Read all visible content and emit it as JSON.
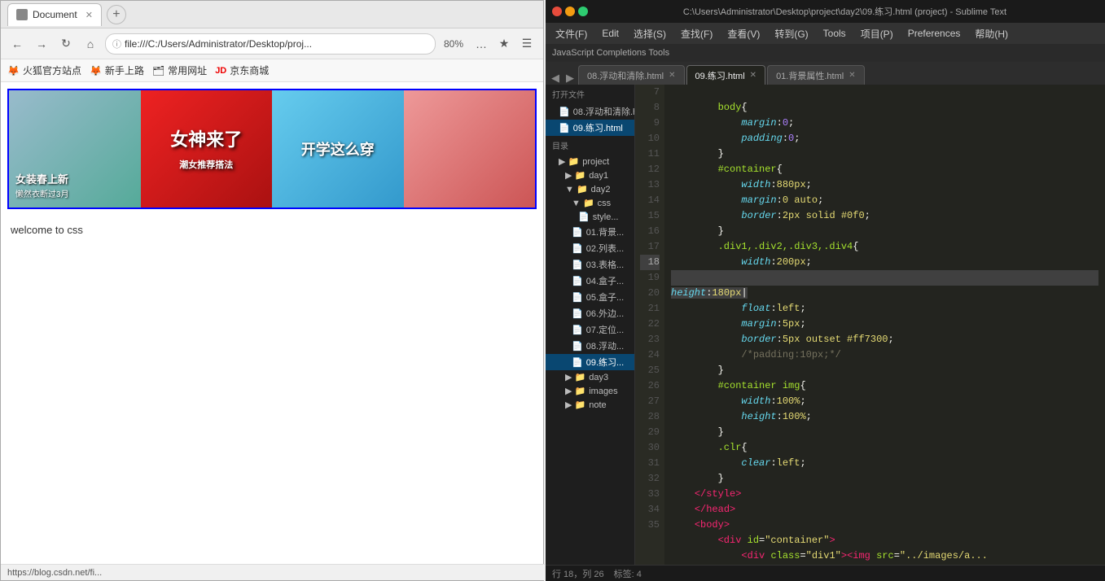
{
  "browser": {
    "tab_label": "Document",
    "tab_favicon": "doc",
    "address": "file:///C:/Users/Administrator/Desktop/proj...",
    "zoom": "80%",
    "bookmarks": [
      {
        "label": "火狐官方站点",
        "icon": "🦊"
      },
      {
        "label": "新手上路",
        "icon": "🦊"
      },
      {
        "label": "常用网址",
        "icon": "🗂"
      },
      {
        "label": "京东商城",
        "icon": "🛒"
      }
    ],
    "welcome_text": "welcome to css",
    "status_url": "https://blog.csdn.net/fi..."
  },
  "images": [
    {
      "label": "女装春上新",
      "sublabel": "懒然衣断过3月"
    },
    {
      "label": "女神来了",
      "sublabel": "潮女推荐搭法"
    },
    {
      "label": "开学这么穿",
      "sublabel": ""
    },
    {
      "label": "",
      "sublabel": ""
    }
  ],
  "sublime": {
    "title": "C:\\Users\\Administrator\\Desktop\\project\\day2\\09.练习.html (project) - Sublime Text",
    "nav_prev": "◀",
    "nav_next": "▶",
    "menu_items": [
      "文件(F)",
      "Edit",
      "选择(S)",
      "查找(F)",
      "查看(V)",
      "转到(G)",
      "Tools",
      "项目(P)",
      "Preferences",
      "帮助(H)"
    ],
    "toolbar_text": "JavaScript Completions Tools",
    "tabs": [
      {
        "label": "08.浮动和清除.html",
        "active": false
      },
      {
        "label": "09.练习.html",
        "active": true
      },
      {
        "label": "01.背景属性.html",
        "active": false
      }
    ],
    "sidebar": {
      "open_files_title": "打开文件",
      "sidebar_items": [
        {
          "label": "08.浮动和清除.html",
          "type": "file",
          "indent": 1,
          "selected": false
        },
        {
          "label": "09.练习.html",
          "type": "file",
          "indent": 1,
          "selected": true
        },
        {
          "label": "目录",
          "type": "folder",
          "indent": 0,
          "selected": false
        },
        {
          "label": "project",
          "type": "folder",
          "indent": 1,
          "selected": false
        },
        {
          "label": "day1",
          "type": "folder",
          "indent": 2,
          "selected": false
        },
        {
          "label": "day2",
          "type": "folder",
          "indent": 2,
          "selected": false
        },
        {
          "label": "css",
          "type": "folder",
          "indent": 3,
          "selected": false
        },
        {
          "label": "style...",
          "type": "file",
          "indent": 4,
          "selected": false
        },
        {
          "label": "01.背景...",
          "type": "file",
          "indent": 3,
          "selected": false
        },
        {
          "label": "02.列表...",
          "type": "file",
          "indent": 3,
          "selected": false
        },
        {
          "label": "03.表格...",
          "type": "file",
          "indent": 3,
          "selected": false
        },
        {
          "label": "04.盒子...",
          "type": "file",
          "indent": 3,
          "selected": false
        },
        {
          "label": "05.盒子...",
          "type": "file",
          "indent": 3,
          "selected": false
        },
        {
          "label": "06.外边...",
          "type": "file",
          "indent": 3,
          "selected": false
        },
        {
          "label": "07.定位...",
          "type": "file",
          "indent": 3,
          "selected": false
        },
        {
          "label": "08.浮动...",
          "type": "file",
          "indent": 3,
          "selected": false
        },
        {
          "label": "09.练习...",
          "type": "file",
          "indent": 3,
          "selected": false
        },
        {
          "label": "day3",
          "type": "folder",
          "indent": 2,
          "selected": false
        },
        {
          "label": "images",
          "type": "folder",
          "indent": 2,
          "selected": false
        },
        {
          "label": "note",
          "type": "folder",
          "indent": 2,
          "selected": false
        }
      ]
    },
    "code_lines": [
      {
        "num": 7,
        "content": "BODY_OPEN"
      },
      {
        "num": 8,
        "content": "MARGIN"
      },
      {
        "num": 9,
        "content": "PADDING"
      },
      {
        "num": 10,
        "content": "CLOSE_BRACE"
      },
      {
        "num": 11,
        "content": "CONTAINER_OPEN"
      },
      {
        "num": 12,
        "content": "WIDTH_880"
      },
      {
        "num": 13,
        "content": "MARGIN_AUTO"
      },
      {
        "num": 14,
        "content": "BORDER"
      },
      {
        "num": 15,
        "content": "CLOSE_BRACE"
      },
      {
        "num": 16,
        "content": "DIV_SELECTOR"
      },
      {
        "num": 17,
        "content": "WIDTH_200"
      },
      {
        "num": 18,
        "content": "HEIGHT_180"
      },
      {
        "num": 19,
        "content": "FLOAT"
      },
      {
        "num": 20,
        "content": "MARGIN_5"
      },
      {
        "num": 21,
        "content": "BORDER_OUTSET"
      },
      {
        "num": 22,
        "content": "COMMENT_PADDING"
      },
      {
        "num": 23,
        "content": "CLOSE_BRACE"
      },
      {
        "num": 24,
        "content": "CONTAINER_IMG"
      },
      {
        "num": 25,
        "content": "WIDTH_100"
      },
      {
        "num": 26,
        "content": "HEIGHT_100"
      },
      {
        "num": 27,
        "content": "CLOSE_BRACE"
      },
      {
        "num": 28,
        "content": "CLR_OPEN"
      },
      {
        "num": 29,
        "content": "CLEAR_LEFT"
      },
      {
        "num": 30,
        "content": "CLOSE_BRACE"
      },
      {
        "num": 31,
        "content": "CLOSE_STYLE"
      },
      {
        "num": 32,
        "content": "CLOSE_HEAD"
      },
      {
        "num": 33,
        "content": "OPEN_BODY"
      },
      {
        "num": 34,
        "content": "DIV_CONTAINER"
      },
      {
        "num": 35,
        "content": "DIV_DIV1"
      }
    ],
    "statusbar": {
      "position": "行 18，列 26",
      "encoding": "标签: 4"
    }
  }
}
